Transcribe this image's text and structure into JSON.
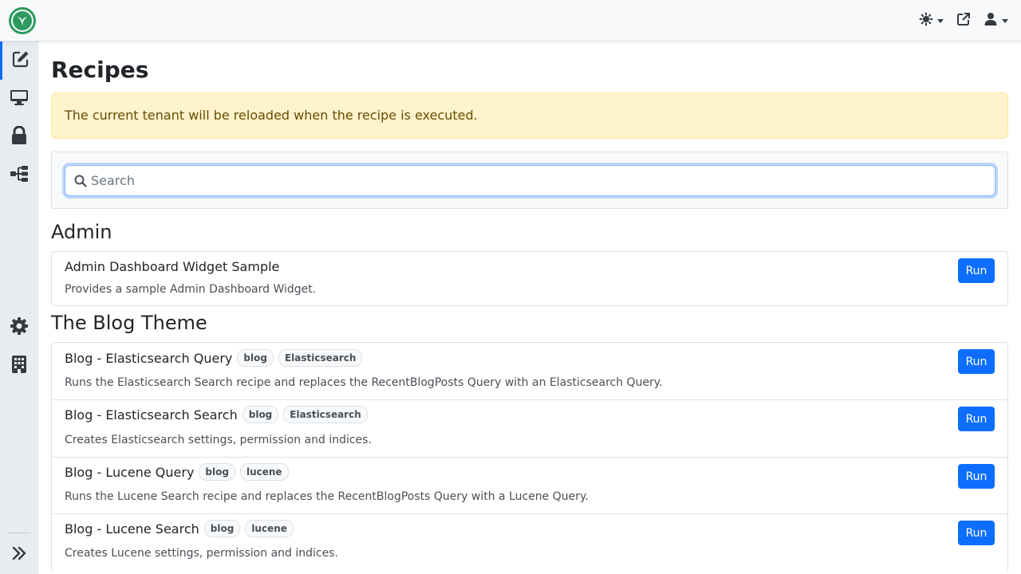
{
  "page": {
    "title": "Recipes"
  },
  "alert": {
    "text": "The current tenant will be reloaded when the recipe is executed."
  },
  "search": {
    "placeholder": "Search",
    "value": ""
  },
  "topbar": {
    "brand_icon": "orchard-logo-icon",
    "actions": [
      "theme-toggle-icon",
      "external-link-icon",
      "user-menu-icon"
    ]
  },
  "sidebar": {
    "items": [
      {
        "icon": "pen-to-square-icon",
        "active": true
      },
      {
        "icon": "desktop-icon",
        "active": false
      },
      {
        "icon": "lock-icon",
        "active": false
      },
      {
        "icon": "sitemap-icon",
        "active": false
      },
      {
        "icon": "gear-icon",
        "active": false
      },
      {
        "icon": "building-icon",
        "active": false
      }
    ],
    "toggle_icon": "double-chevron-right-icon"
  },
  "groups": [
    {
      "title": "Admin",
      "recipes": [
        {
          "name": "Admin Dashboard Widget Sample",
          "tags": [],
          "description": "Provides a sample Admin Dashboard Widget.",
          "action": "Run"
        }
      ]
    },
    {
      "title": "The Blog Theme",
      "recipes": [
        {
          "name": "Blog - Elasticsearch Query",
          "tags": [
            "blog",
            "Elasticsearch"
          ],
          "description": "Runs the Elasticsearch Search recipe and replaces the RecentBlogPosts Query with an Elasticsearch Query.",
          "action": "Run"
        },
        {
          "name": "Blog - Elasticsearch Search",
          "tags": [
            "blog",
            "Elasticsearch"
          ],
          "description": "Creates Elasticsearch settings, permission and indices.",
          "action": "Run"
        },
        {
          "name": "Blog - Lucene Query",
          "tags": [
            "blog",
            "lucene"
          ],
          "description": "Runs the Lucene Search recipe and replaces the RecentBlogPosts Query with a Lucene Query.",
          "action": "Run"
        },
        {
          "name": "Blog - Lucene Search",
          "tags": [
            "blog",
            "lucene"
          ],
          "description": "Creates Lucene settings, permission and indices.",
          "action": "Run"
        }
      ]
    }
  ],
  "colors": {
    "primary": "#0d6efd",
    "alert_bg": "#fff3cd",
    "alert_text": "#664d03"
  }
}
